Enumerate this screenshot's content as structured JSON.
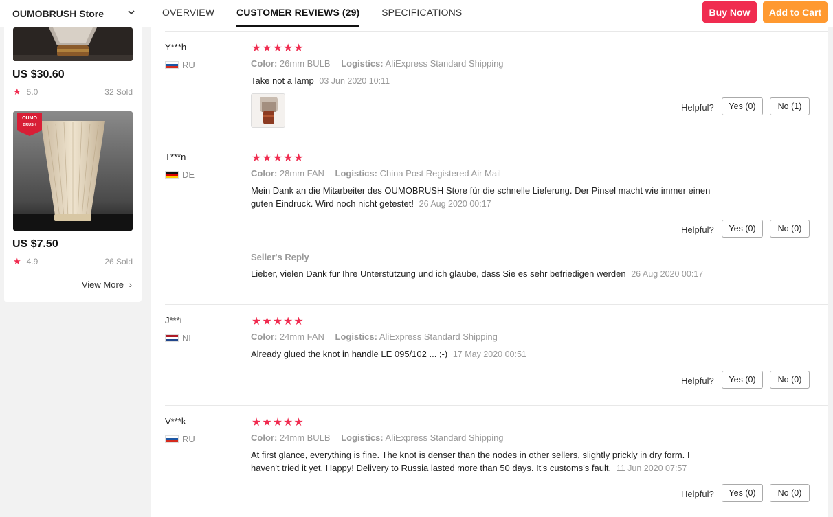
{
  "header": {
    "store_name": "OUMOBRUSH Store",
    "tabs": [
      {
        "label": "OVERVIEW"
      },
      {
        "label": "CUSTOMER REVIEWS (29)"
      },
      {
        "label": "SPECIFICATIONS"
      }
    ],
    "buy_now": "Buy Now",
    "add_to_cart": "Add to Cart",
    "colors": {
      "buy": "#f02c50",
      "cart": "#ff9930"
    }
  },
  "sidebar": {
    "products": [
      {
        "price": "US $30.60",
        "rating": "5.0",
        "sold": "32 Sold"
      },
      {
        "price": "US $7.50",
        "rating": "4.9",
        "sold": "26 Sold",
        "badge_line1": "OUMO",
        "badge_line2": "BRUSH"
      }
    ],
    "view_more": "View More"
  },
  "reviews": {
    "helpful_label": "Helpful?",
    "color_label": "Color:",
    "logistics_label": "Logistics:",
    "stars": "★★★★★",
    "items": [
      {
        "user": "Y***h",
        "country": "RU",
        "color": "26mm BULB",
        "logistics": "AliExpress Standard Shipping",
        "text": "Take not a lamp",
        "date": "03 Jun 2020 10:11",
        "yes": "Yes (0)",
        "no": "No (1)"
      },
      {
        "user": "T***n",
        "country": "DE",
        "color": "28mm FAN",
        "logistics": "China Post Registered Air Mail",
        "text": "Mein Dank an die Mitarbeiter des OUMOBRUSH Store für die schnelle Lieferung. Der Pinsel macht wie immer einen guten Eindruck. Wird noch nicht getestet!",
        "date": "26 Aug 2020 00:17",
        "yes": "Yes (0)",
        "no": "No (0)",
        "seller_reply_label": "Seller's Reply",
        "seller_reply": "Lieber, vielen Dank für Ihre Unterstützung und ich glaube, dass Sie es sehr befriedigen werden",
        "seller_reply_date": "26 Aug 2020 00:17"
      },
      {
        "user": "J***t",
        "country": "NL",
        "color": "24mm FAN",
        "logistics": "AliExpress Standard Shipping",
        "text": "Already glued the knot in handle LE 095/102 ... ;-)",
        "date": "17 May 2020 00:51",
        "yes": "Yes (0)",
        "no": "No (0)"
      },
      {
        "user": "V***k",
        "country": "RU",
        "color": "24mm BULB",
        "logistics": "AliExpress Standard Shipping",
        "text": "At first glance, everything is fine. The knot is denser than the nodes in other sellers, slightly prickly in dry form. I haven't tried it yet. Happy! Delivery to Russia lasted more than 50 days. It's customs's fault.",
        "date": "11 Jun 2020 07:57",
        "yes": "Yes (0)",
        "no": "No (0)"
      }
    ]
  }
}
